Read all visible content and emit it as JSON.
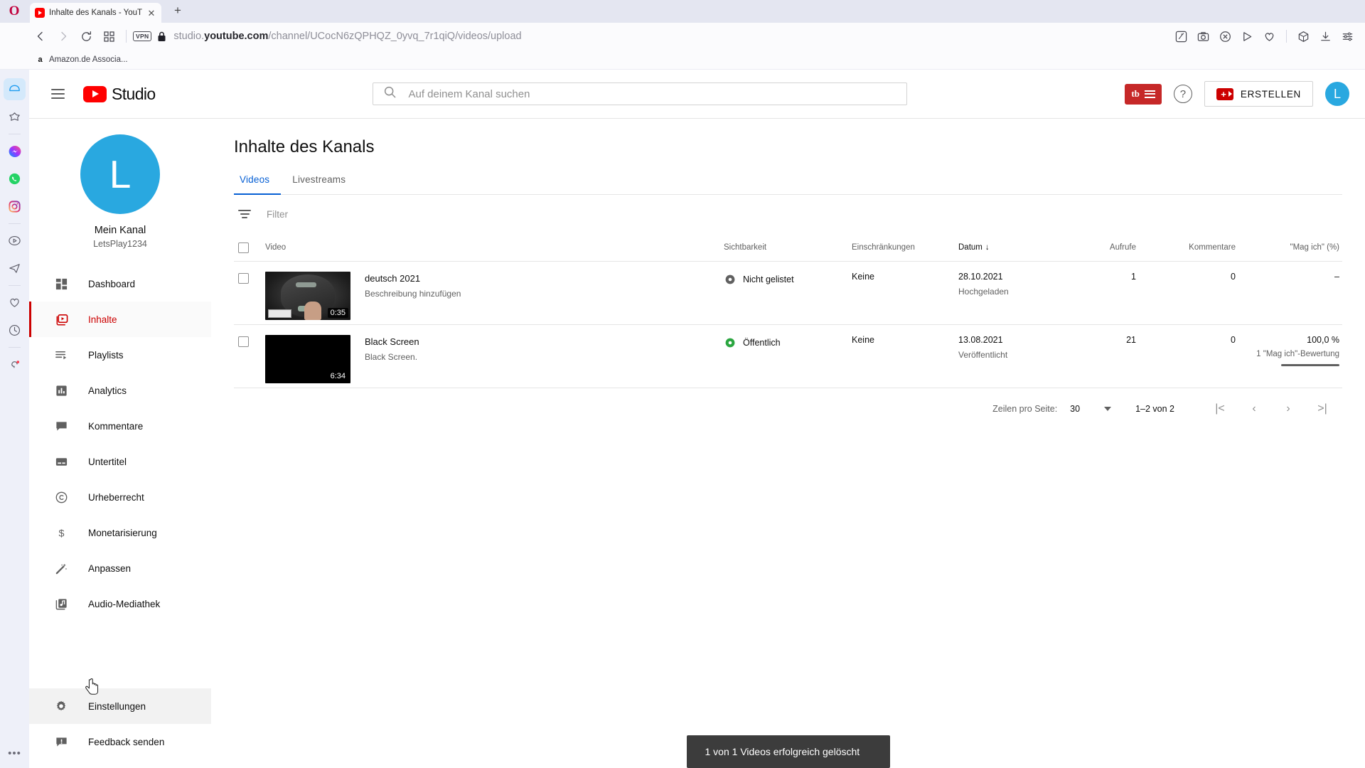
{
  "browser": {
    "name": "opera",
    "tab": {
      "title": "Inhalte des Kanals - YouTu",
      "favicon": "youtube-icon",
      "close_label": "✕"
    },
    "new_tab_label": "+",
    "nav": {
      "back": "back-icon",
      "forward": "forward-icon",
      "reload": "reload-icon",
      "tiles": "tiles-icon",
      "vpn_label": "VPN",
      "lock": "lock-icon",
      "url_prefix": "studio.",
      "url_domain": "youtube.com",
      "url_path": "/channel/UCocN6zQPHQZ_0yvq_7r1qiQ/videos/upload"
    },
    "toolbar_icons": [
      "messenger-pin-icon",
      "snapshot-icon",
      "adblock-icon",
      "player-icon",
      "heart-icon",
      "cube-icon",
      "download-icon",
      "settings-sliders-icon"
    ],
    "bookmarks": [
      {
        "label": "Amazon.de Associa...",
        "icon": "amazon-icon"
      }
    ],
    "rail_icons": [
      "home-icon",
      "pin-star-icon",
      "messenger-icon",
      "whatsapp-icon",
      "instagram-icon",
      "player-icon",
      "telegram-icon",
      "heart-icon",
      "history-icon",
      "tips-icon"
    ],
    "rail_more": "•••"
  },
  "studio": {
    "header": {
      "menu_icon": "hamburger-icon",
      "logo_text": "Studio",
      "search_placeholder": "Auf deinem Kanal suchen",
      "search_value": "",
      "search_icon": "search-icon",
      "tubebuddy_label": "tb",
      "help_label": "?",
      "create_label": "ERSTELLEN",
      "avatar_initial": "L"
    },
    "sidebar": {
      "avatar_initial": "L",
      "channel_name": "Mein Kanal",
      "channel_handle": "LetsPlay1234",
      "items": [
        {
          "label": "Dashboard",
          "icon": "dashboard-icon",
          "active": false
        },
        {
          "label": "Inhalte",
          "icon": "content-icon",
          "active": true
        },
        {
          "label": "Playlists",
          "icon": "playlist-icon",
          "active": false
        },
        {
          "label": "Analytics",
          "icon": "analytics-icon",
          "active": false
        },
        {
          "label": "Kommentare",
          "icon": "comment-icon",
          "active": false
        },
        {
          "label": "Untertitel",
          "icon": "subtitles-icon",
          "active": false
        },
        {
          "label": "Urheberrecht",
          "icon": "copyright-icon",
          "active": false
        },
        {
          "label": "Monetarisierung",
          "icon": "dollar-icon",
          "active": false
        },
        {
          "label": "Anpassen",
          "icon": "magic-wand-icon",
          "active": false
        },
        {
          "label": "Audio-Mediathek",
          "icon": "audio-library-icon",
          "active": false
        }
      ],
      "bottom_items": [
        {
          "label": "Einstellungen",
          "icon": "gear-icon",
          "hovered": true
        },
        {
          "label": "Feedback senden",
          "icon": "feedback-icon",
          "hovered": false
        }
      ]
    },
    "main": {
      "page_title": "Inhalte des Kanals",
      "tabs": [
        {
          "label": "Videos",
          "selected": true
        },
        {
          "label": "Livestreams",
          "selected": false
        }
      ],
      "filter": {
        "icon": "filter-icon",
        "placeholder": "Filter",
        "value": ""
      },
      "table": {
        "columns": {
          "video": "Video",
          "visibility": "Sichtbarkeit",
          "restrictions": "Einschränkungen",
          "date": "Datum",
          "date_sort_arrow": "↓",
          "views": "Aufrufe",
          "comments": "Kommentare",
          "likes": "\"Mag ich\" (%)"
        },
        "rows": [
          {
            "checked": false,
            "thumb_style": "hdd",
            "duration": "0:35",
            "title": "deutsch 2021",
            "description": "Beschreibung hinzufügen",
            "visibility": "Nicht gelistet",
            "visibility_icon": "unlisted-eye-icon",
            "visibility_color": "#606060",
            "restrictions": "Keine",
            "date": "28.10.2021",
            "date_status": "Hochgeladen",
            "views": "1",
            "comments": "0",
            "likes": "–",
            "likes_sub": "",
            "likes_bar": 0
          },
          {
            "checked": false,
            "thumb_style": "black",
            "duration": "6:34",
            "title": "Black Screen",
            "description": "Black Screen.",
            "visibility": "Öffentlich",
            "visibility_icon": "public-eye-icon",
            "visibility_color": "#2ba640",
            "restrictions": "Keine",
            "date": "13.08.2021",
            "date_status": "Veröffentlicht",
            "views": "21",
            "comments": "0",
            "likes": "100,0 %",
            "likes_sub": "1 \"Mag ich\"-Bewertung",
            "likes_bar": 100
          }
        ]
      },
      "pagination": {
        "rows_label": "Zeilen pro Seite:",
        "rows_value": "30",
        "range": "1–2 von 2",
        "first": "|<",
        "prev": "‹",
        "next": "›",
        "last": ">|"
      },
      "toast": {
        "message": "1 von 1 Videos erfolgreich gelöscht"
      }
    }
  },
  "colors": {
    "youtube_red": "#ff0000",
    "accent_blue": "#065fd4",
    "public_green": "#2ba640",
    "avatar_blue": "#29a8e0",
    "toast_bg": "#3c3c3c"
  }
}
